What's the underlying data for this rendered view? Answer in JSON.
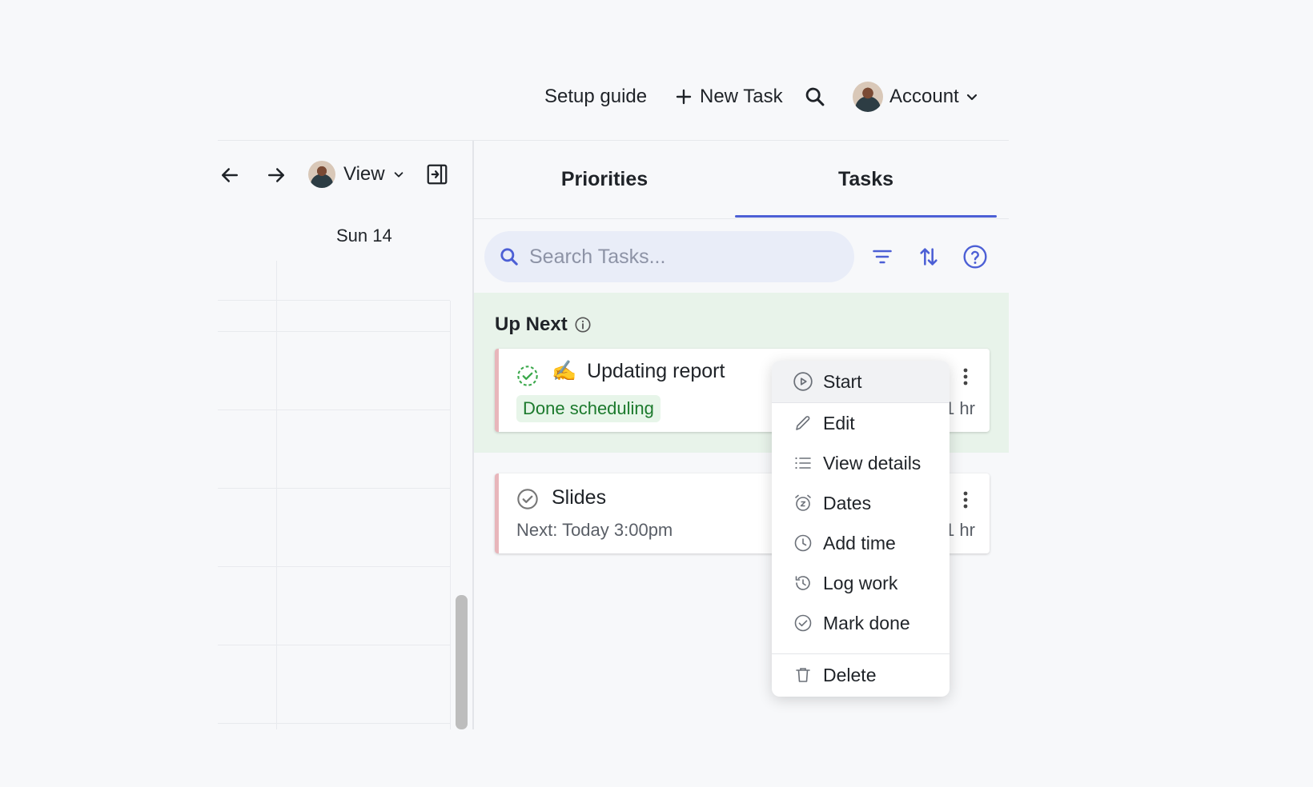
{
  "topbar": {
    "setup_guide": "Setup guide",
    "new_task": "New Task",
    "account": "Account"
  },
  "calendar": {
    "view_label": "View",
    "day_label": "Sun 14"
  },
  "tabs": [
    {
      "label": "Priorities",
      "active": false
    },
    {
      "label": "Tasks",
      "active": true
    }
  ],
  "search": {
    "placeholder": "Search Tasks..."
  },
  "up_next": {
    "title": "Up Next"
  },
  "tasks": [
    {
      "emoji": "✍️",
      "title": "Updating report",
      "badge": "Done scheduling",
      "duration": "1 hr"
    },
    {
      "title": "Slides",
      "subtitle": "Next: Today 3:00pm",
      "duration": "1 hr"
    }
  ],
  "context_menu": {
    "items": [
      {
        "label": "Start",
        "icon": "play-circle-icon"
      },
      {
        "label": "Edit",
        "icon": "pencil-icon"
      },
      {
        "label": "View details",
        "icon": "list-icon"
      },
      {
        "label": "Dates",
        "icon": "alarm-clock-icon"
      },
      {
        "label": "Add time",
        "icon": "clock-icon"
      },
      {
        "label": "Log work",
        "icon": "history-icon"
      },
      {
        "label": "Mark done",
        "icon": "check-circle-icon"
      },
      {
        "label": "Delete",
        "icon": "trash-icon"
      }
    ]
  },
  "colors": {
    "accent": "#4c5fd5",
    "up_next_bg": "#e8f3ea",
    "badge_bg": "#e7f5e9",
    "badge_text": "#1c7a2d",
    "card_border": "#e8b6bb"
  }
}
